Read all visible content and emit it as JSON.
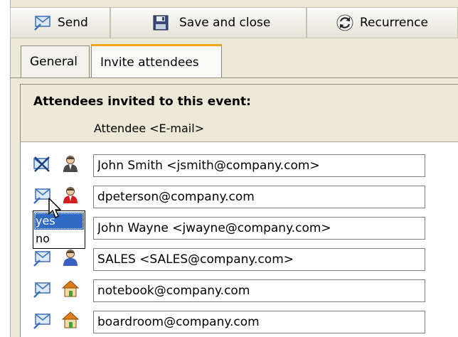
{
  "toolbar": {
    "send_label": "Send",
    "save_close_label": "Save and close",
    "recurrence_label": "Recurrence"
  },
  "tabs": [
    {
      "label": "General",
      "active": false
    },
    {
      "label": "Invite attendees",
      "active": true
    }
  ],
  "panel": {
    "title": "Attendees invited to this event:",
    "column_header": "Attendee <E-mail>"
  },
  "attendees": [
    {
      "value": "John Smith <jsmith@company.com>",
      "send_icon": "envelope-crossed-icon",
      "type_icon": "user-icon"
    },
    {
      "value": "dpeterson@company.com",
      "send_icon": "envelope-icon",
      "type_icon": "user-red-icon"
    },
    {
      "value": "John Wayne <jwayne@company.com>",
      "send_icon": "envelope-icon",
      "type_icon": "user-icon"
    },
    {
      "value": "SALES <SALES@company.com>",
      "send_icon": "envelope-icon",
      "type_icon": "group-icon"
    },
    {
      "value": "notebook@company.com",
      "send_icon": "envelope-icon",
      "type_icon": "resource-icon"
    },
    {
      "value": "boardroom@company.com",
      "send_icon": "envelope-icon",
      "type_icon": "resource-icon"
    }
  ],
  "send_dropdown": {
    "options": [
      "yes",
      "no"
    ],
    "selected": "yes"
  },
  "colors": {
    "window_bg": "#ece9d8",
    "active_tab_accent": "#f5a623",
    "selection": "#316ac5"
  }
}
